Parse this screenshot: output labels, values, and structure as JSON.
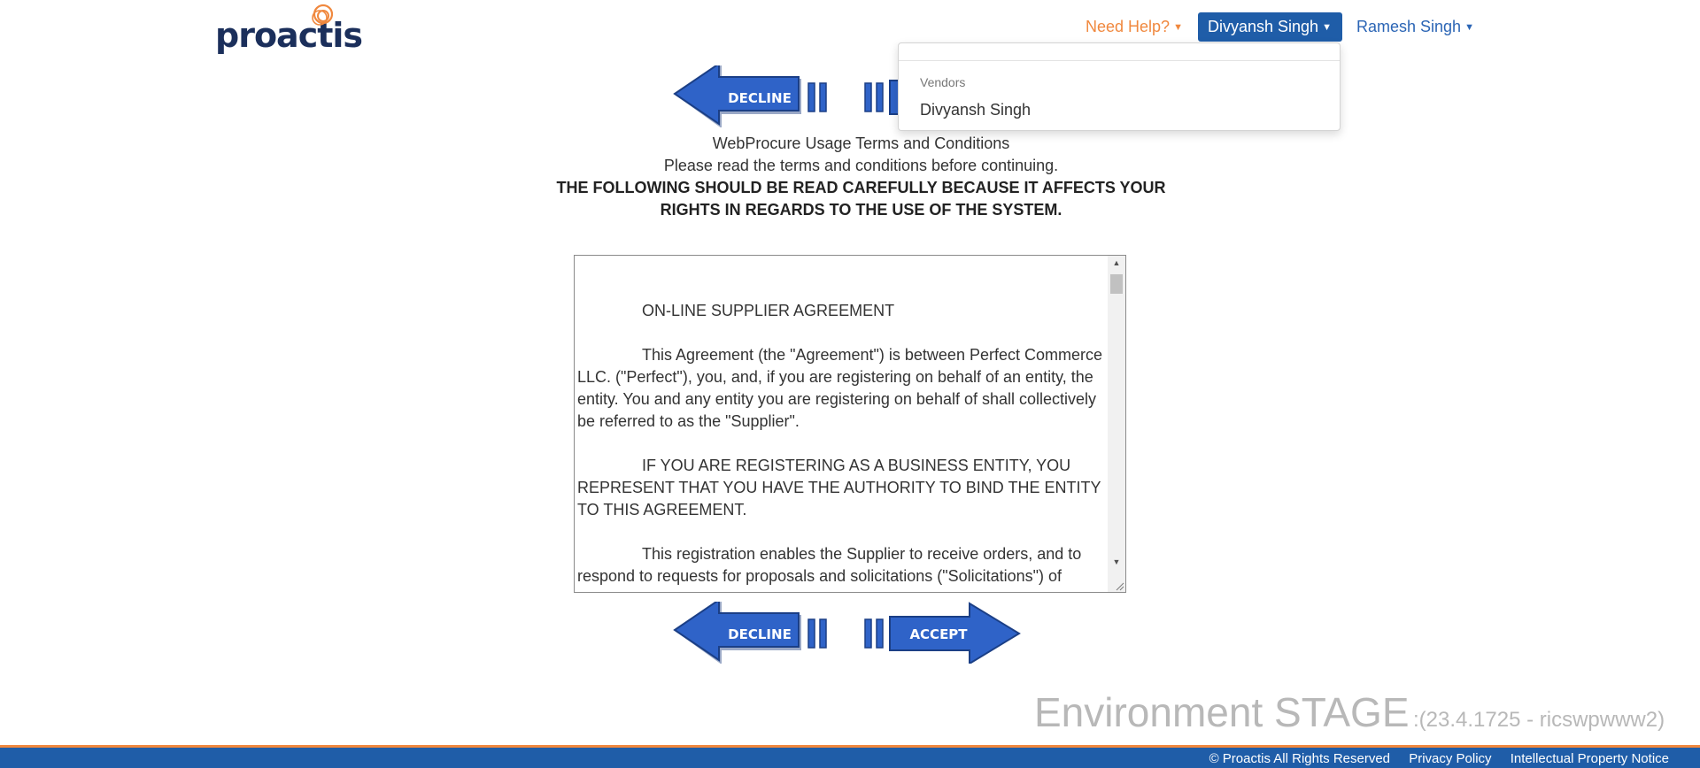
{
  "header": {
    "logo_text": "proactis",
    "help_label": "Need Help?",
    "active_user": "Divyansh Singh",
    "other_user": "Ramesh Singh"
  },
  "user_menu": {
    "section_header": "Vendors",
    "items": [
      "Divyansh Singh"
    ]
  },
  "actions": {
    "decline_label": "DECLINE",
    "accept_label": "ACCEPT"
  },
  "intro": {
    "title": "WebProcure Usage Terms and Conditions",
    "instruction": "Please read the terms and conditions before continuing.",
    "warning": "THE FOLLOWING SHOULD BE READ CAREFULLY BECAUSE IT AFFECTS YOUR RIGHTS IN REGARDS TO THE USE OF THE SYSTEM."
  },
  "terms": {
    "heading": "ON-LINE SUPPLIER AGREEMENT",
    "paragraphs": [
      "This Agreement (the \"Agreement\") is between Perfect Commerce LLC. (\"Perfect\"), you, and, if you are registering on behalf of an entity, the entity. You and any entity you are registering on behalf of shall collectively be referred to as the \"Supplier\".",
      "IF YOU ARE REGISTERING AS A BUSINESS ENTITY, YOU REPRESENT THAT YOU HAVE THE AUTHORITY TO BIND THE ENTITY TO THIS AGREEMENT.",
      "This registration enables the Supplier to receive orders, and to respond to requests for proposals and solicitations (\"Solicitations\") of"
    ]
  },
  "environment": {
    "label": "Environment STAGE",
    "build": ":(23.4.1725 - ricswpwww2)"
  },
  "footer": {
    "copyright": "© Proactis All Rights Reserved",
    "privacy": "Privacy Policy",
    "ip_notice": "Intellectual Property Notice"
  },
  "colors": {
    "brand_navy": "#1b2f5b",
    "brand_orange": "#f0883e",
    "primary_blue": "#1f5da8",
    "arrow_blue": "#2f63c8",
    "muted_text": "#b8b8b8"
  }
}
